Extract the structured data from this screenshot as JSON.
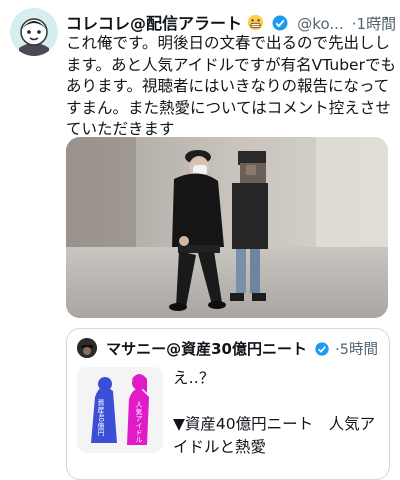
{
  "tweet": {
    "display_name": "コレコレ@配信アラート",
    "handle": "@ko...",
    "time": "1時間",
    "more_icon": "more-dots-icon",
    "text": "これ俺です。明後日の文春で出るので先出しします。あと人気アイドルですが有名VTuberでもあります。視聴者にはいきなりの報告になってすまん。また熱愛についてはコメント控えさせていただきます"
  },
  "quote": {
    "display_name": "マサニー@資産30億円ニート",
    "time": "5時間",
    "text_line1": "え‥？",
    "text_line2": "▼資産40億円ニート　人気アイドルと熱愛",
    "thumbnail_labels": [
      "資産40億円",
      "人気アイドル"
    ]
  },
  "colors": {
    "verified": "#1d9bf0",
    "secondary_text": "#536471",
    "border": "#cfd9de"
  }
}
